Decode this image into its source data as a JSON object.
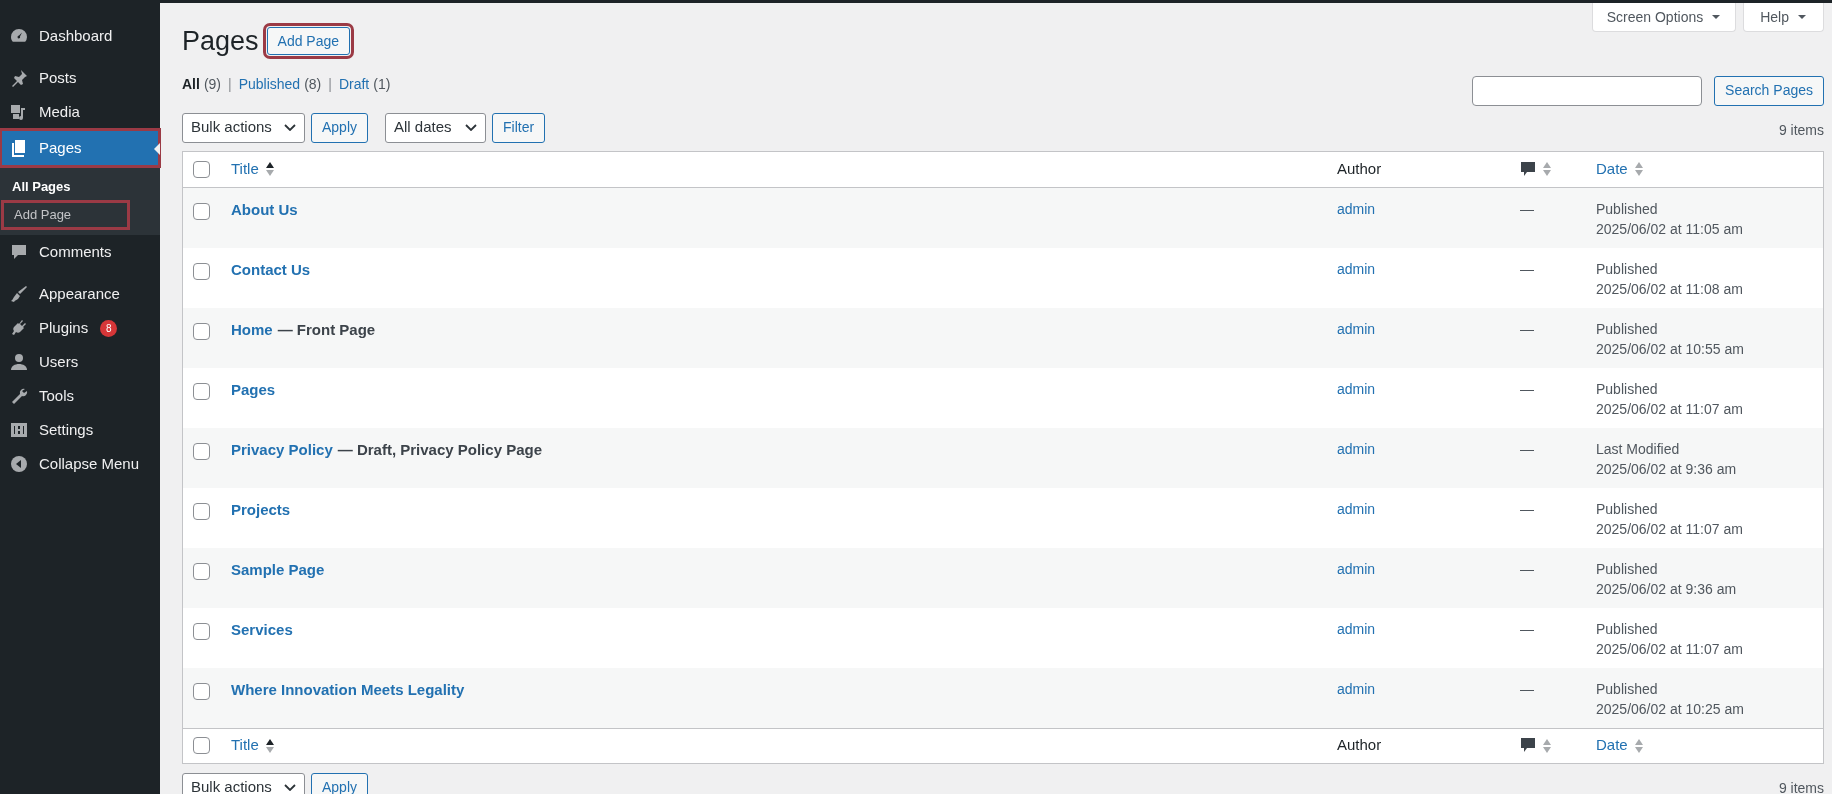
{
  "sidebar": {
    "items": [
      {
        "label": "Dashboard",
        "selected": false,
        "highlighted": false
      },
      {
        "label": "Posts",
        "selected": false,
        "highlighted": false
      },
      {
        "label": "Media",
        "selected": false,
        "highlighted": false
      },
      {
        "label": "Pages",
        "selected": true,
        "highlighted": true,
        "children": [
          {
            "label": "All Pages",
            "selected": true,
            "highlighted": false
          },
          {
            "label": "Add Page",
            "selected": false,
            "highlighted": true
          }
        ]
      },
      {
        "label": "Comments",
        "selected": false,
        "highlighted": false
      },
      {
        "label": "Appearance",
        "selected": false,
        "highlighted": false
      },
      {
        "label": "Plugins",
        "selected": false,
        "highlighted": false,
        "badge": "8"
      },
      {
        "label": "Users",
        "selected": false,
        "highlighted": false
      },
      {
        "label": "Tools",
        "selected": false,
        "highlighted": false
      },
      {
        "label": "Settings",
        "selected": false,
        "highlighted": false
      },
      {
        "label": "Collapse Menu",
        "selected": false,
        "highlighted": false
      }
    ]
  },
  "header": {
    "title": "Pages",
    "add_button": {
      "label": "Add Page",
      "highlighted": true
    },
    "screen_options": "Screen Options",
    "help": "Help"
  },
  "filters": [
    {
      "label": "All",
      "count": "(9)",
      "selected": true
    },
    {
      "separator": "|",
      "label": "Published",
      "count": "(8)",
      "selected": false
    },
    {
      "separator": "|",
      "label": "Draft",
      "count": "(1)",
      "selected": false
    }
  ],
  "search": {
    "button": "Search Pages"
  },
  "toolbar": {
    "bulk_actions": "Bulk actions",
    "apply": "Apply",
    "dates": "All dates",
    "filter": "Filter",
    "count": "9 items"
  },
  "table": {
    "select_all_checked": false,
    "columns": [
      {
        "label": "Title",
        "kind": "sorted"
      },
      {
        "label": "Author",
        "kind": "plain"
      },
      {
        "kind": "comment"
      },
      {
        "label": "Date",
        "kind": "sortable"
      }
    ],
    "rows": [
      {
        "checked": false,
        "title": "About Us",
        "author": "admin",
        "comments": "—",
        "status": "Published",
        "date": "2025/06/02 at 11:05 am"
      },
      {
        "checked": false,
        "title": "Contact Us",
        "author": "admin",
        "comments": "—",
        "status": "Published",
        "date": "2025/06/02 at 11:08 am"
      },
      {
        "checked": false,
        "title": "Home",
        "state": "— Front Page",
        "author": "admin",
        "comments": "—",
        "status": "Published",
        "date": "2025/06/02 at 10:55 am"
      },
      {
        "checked": false,
        "title": "Pages",
        "author": "admin",
        "comments": "—",
        "status": "Published",
        "date": "2025/06/02 at 11:07 am"
      },
      {
        "checked": false,
        "title": "Privacy Policy",
        "state": "— Draft, Privacy Policy Page",
        "author": "admin",
        "comments": "—",
        "status": "Last Modified",
        "date": "2025/06/02 at 9:36 am"
      },
      {
        "checked": false,
        "title": "Projects",
        "author": "admin",
        "comments": "—",
        "status": "Published",
        "date": "2025/06/02 at 11:07 am"
      },
      {
        "checked": false,
        "title": "Sample Page",
        "author": "admin",
        "comments": "—",
        "status": "Published",
        "date": "2025/06/02 at 9:36 am"
      },
      {
        "checked": false,
        "title": "Services",
        "author": "admin",
        "comments": "—",
        "status": "Published",
        "date": "2025/06/02 at 11:07 am"
      },
      {
        "checked": false,
        "title": "Where Innovation Meets Legality",
        "author": "admin",
        "comments": "—",
        "status": "Published",
        "date": "2025/06/02 at 10:25 am"
      }
    ],
    "footer_select_all_checked": false,
    "footer_columns": [
      {
        "label": "Title",
        "kind": "sorted"
      },
      {
        "label": "Author",
        "kind": "plain"
      },
      {
        "kind": "comment"
      },
      {
        "label": "Date",
        "kind": "sortable"
      }
    ]
  },
  "bottom_toolbar": {
    "bulk_actions": "Bulk actions",
    "apply": "Apply",
    "count": "9 items"
  }
}
